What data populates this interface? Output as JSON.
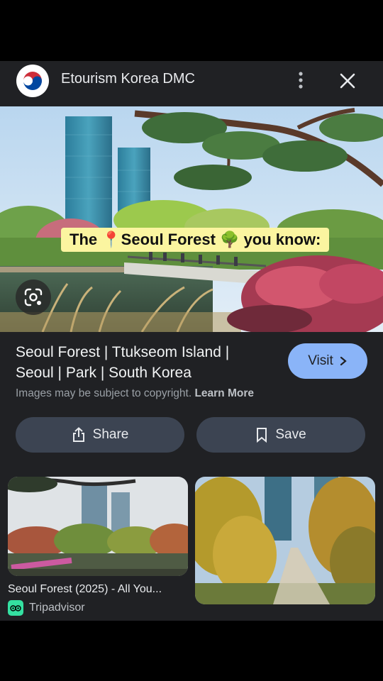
{
  "header": {
    "site_name": "Etourism Korea DMC",
    "logo_icon": "taegeuk-logo-icon",
    "menu_icon": "more-vert-icon",
    "close_icon": "close-icon"
  },
  "hero": {
    "caption_prefix": "The",
    "caption_place": "Seoul Forest",
    "caption_suffix": "you know:",
    "pin_emoji": "📍",
    "tree_emoji": "🌳",
    "lens_icon": "google-lens-icon"
  },
  "result": {
    "title": "Seoul Forest | Ttukseom Island | Seoul | Park | South Korea",
    "visit_label": "Visit",
    "copyright_text": "Images may be subject to copyright.",
    "learn_more": "Learn More"
  },
  "actions": {
    "share_label": "Share",
    "save_label": "Save"
  },
  "related": [
    {
      "title": "Seoul Forest (2025) - All You...",
      "source": "Tripadvisor"
    },
    {
      "title": "",
      "source": ""
    }
  ],
  "colors": {
    "sheet_bg": "#202124",
    "visit_bg": "#8ab4f8",
    "button_bg": "#3c4452",
    "caption_bg": "#fbf5a0",
    "tripadvisor": "#34e0a1"
  }
}
